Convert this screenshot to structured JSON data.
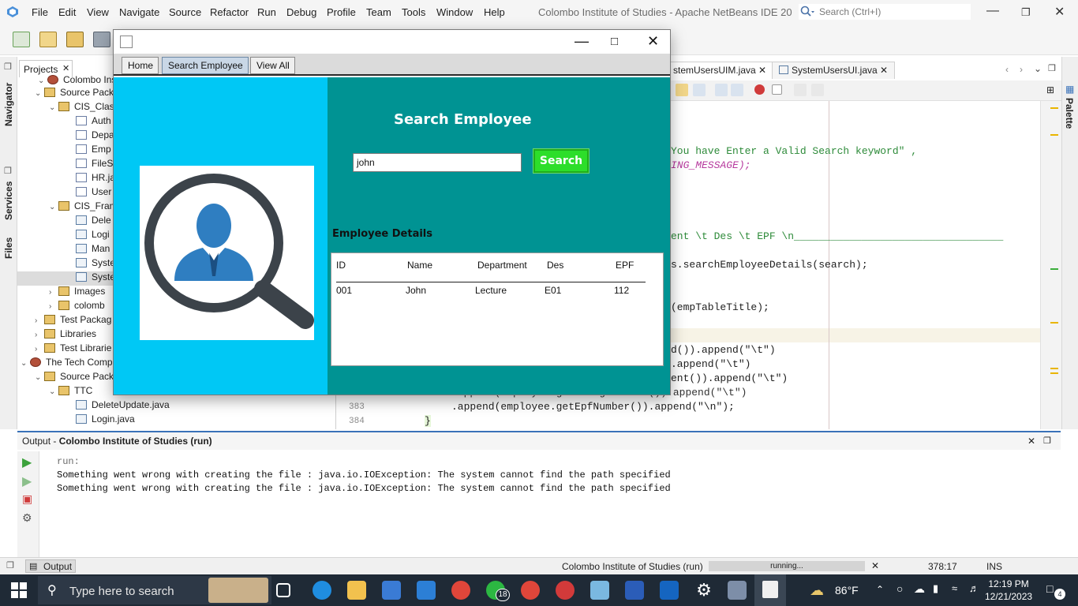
{
  "menubar": {
    "items": [
      "File",
      "Edit",
      "View",
      "Navigate",
      "Source",
      "Refactor",
      "Run",
      "Debug",
      "Profile",
      "Team",
      "Tools",
      "Window",
      "Help"
    ],
    "app_title": "Colombo Institute of Studies - Apache NetBeans IDE 20",
    "search_placeholder": "Search (Ctrl+I)"
  },
  "side_tabs": {
    "navigator": "Navigator",
    "services": "Services",
    "files": "Files",
    "palette": "Palette"
  },
  "projects": {
    "tab_label": "Projects",
    "tree": [
      "Colombo Institu",
      "Source Pack",
      "CIS_Clas",
      "Auth",
      "Depa",
      "Emp",
      "FileS",
      "HR.ja",
      "User",
      "CIS_Fram",
      "Dele",
      "Logi",
      "Man",
      "Syste",
      "Syste",
      "Images",
      "colomb",
      "Test Packag",
      "Libraries",
      "Test Librarie",
      "The Tech Comp",
      "Source Pack",
      "TTC",
      "DeleteUpdate.java",
      "Login.java"
    ]
  },
  "editor": {
    "tabs": [
      "stemUsersUIM.java",
      "SystemUsersUI.java"
    ],
    "code_lines": [
      "You have Enter a Valid Search keyword\" ,",
      "ING_MESSAGE);",
      "ent \\t Des \\t EPF \\n",
      "s.searchEmployeeDetails(search);",
      "(empTableTitle);",
      "d()).append(\"\\t\")",
      ".append(\"\\t\")",
      "ent()).append(\"\\t\")",
      ".append(employee.getDesignations()).append(\"\\t\")",
      ".append(employee.getEpfNumber()).append(\"\\n\");",
      "}"
    ],
    "line_numbers": [
      "382",
      "383",
      "384"
    ]
  },
  "output": {
    "title_prefix": "Output - ",
    "title": "Colombo Institute of Studies (run)",
    "lines": [
      "run:",
      "Something went wrong with creating the file : java.io.IOException: The system cannot find the path specified",
      "Something went wrong with creating the file : java.io.IOException: The system cannot find the path specified"
    ]
  },
  "statusbar": {
    "output_tab": "Output",
    "run_label": "Colombo Institute of Studies (run)",
    "progress_label": "running...",
    "position": "378:17",
    "mode": "INS"
  },
  "taskbar": {
    "search_placeholder": "Type here to search",
    "weather": "86°F",
    "time": "12:19 PM",
    "date": "12/21/2023",
    "whatsapp_badge": "18",
    "notif_count": "4"
  },
  "dialog": {
    "tabs": [
      "Home",
      "Search Employee",
      "View All"
    ],
    "active_tab": "Search Employee",
    "heading": "Search Employee",
    "search_value": "john",
    "search_button": "Search",
    "details_label": "Employee Details",
    "table": {
      "headers": [
        "ID",
        "Name",
        "Department",
        "Des",
        "EPF"
      ],
      "rows": [
        [
          "001",
          "John",
          "Lecture",
          "E01",
          "112"
        ]
      ]
    }
  },
  "colors": {
    "left_panel": "#00c8f5",
    "right_panel": "#009393",
    "search_button": "#2dde2a",
    "taskbar": "#1f2a36",
    "output_accent": "#3a72b9"
  }
}
